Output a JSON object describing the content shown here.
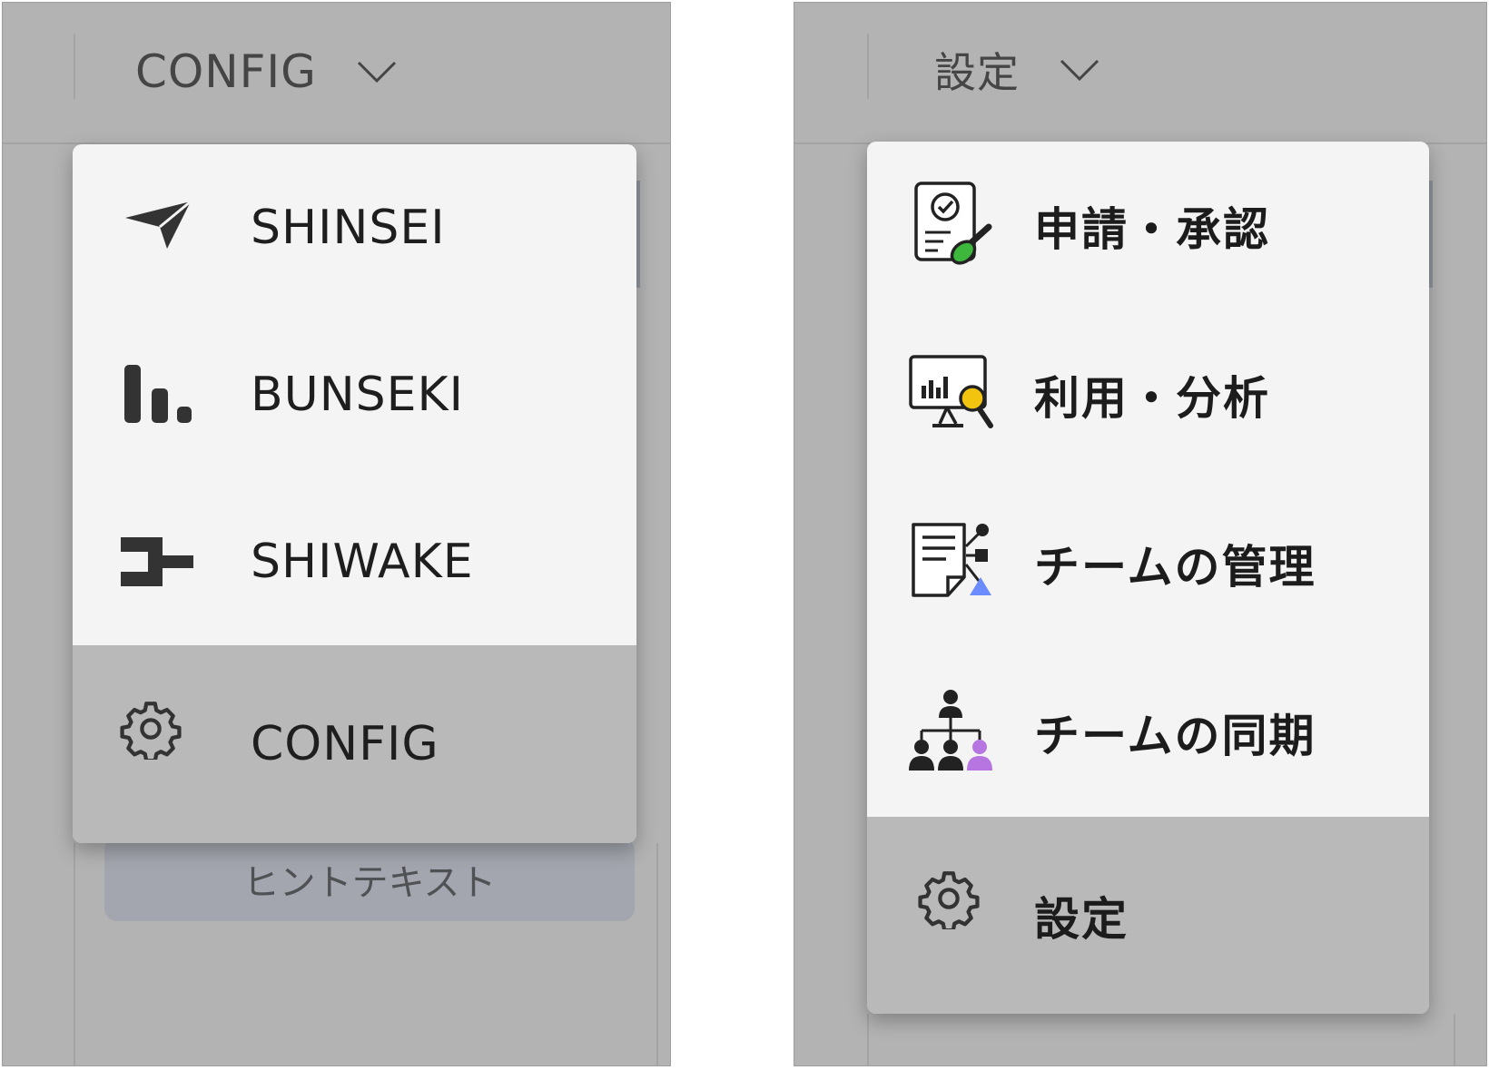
{
  "left_panel": {
    "trigger_label": "CONFIG",
    "menu_items": [
      {
        "label": "SHINSEI",
        "icon": "paper-plane-icon",
        "active": false
      },
      {
        "label": "BUNSEKI",
        "icon": "bar-chart-icon",
        "active": false
      },
      {
        "label": "SHIWAKE",
        "icon": "bracket-connector-icon",
        "active": false
      },
      {
        "label": "CONFIG",
        "icon": "gear-icon",
        "active": true
      }
    ],
    "hint_text": "ヒントテキスト"
  },
  "right_panel": {
    "trigger_label": "設定",
    "menu_items": [
      {
        "label": "申請・承認",
        "icon": "approval-stamp-icon",
        "active": false
      },
      {
        "label": "利用・分析",
        "icon": "analytics-monitor-icon",
        "active": false
      },
      {
        "label": "チームの管理",
        "icon": "team-document-icon",
        "active": false
      },
      {
        "label": "チームの同期",
        "icon": "org-chart-icon",
        "active": false
      },
      {
        "label": "設定",
        "icon": "gear-icon",
        "active": true
      }
    ]
  },
  "colors": {
    "backdrop": "#b3b3b3",
    "menu_bg": "#f4f4f4",
    "active_item_bg": "#b9b9b9",
    "hint_field_bg": "#a3a6ae",
    "stamp_green": "#3db83d",
    "magnifier_yellow": "#f2c40f",
    "triangle_blue": "#6b8cff",
    "member_purple": "#b675e0"
  }
}
